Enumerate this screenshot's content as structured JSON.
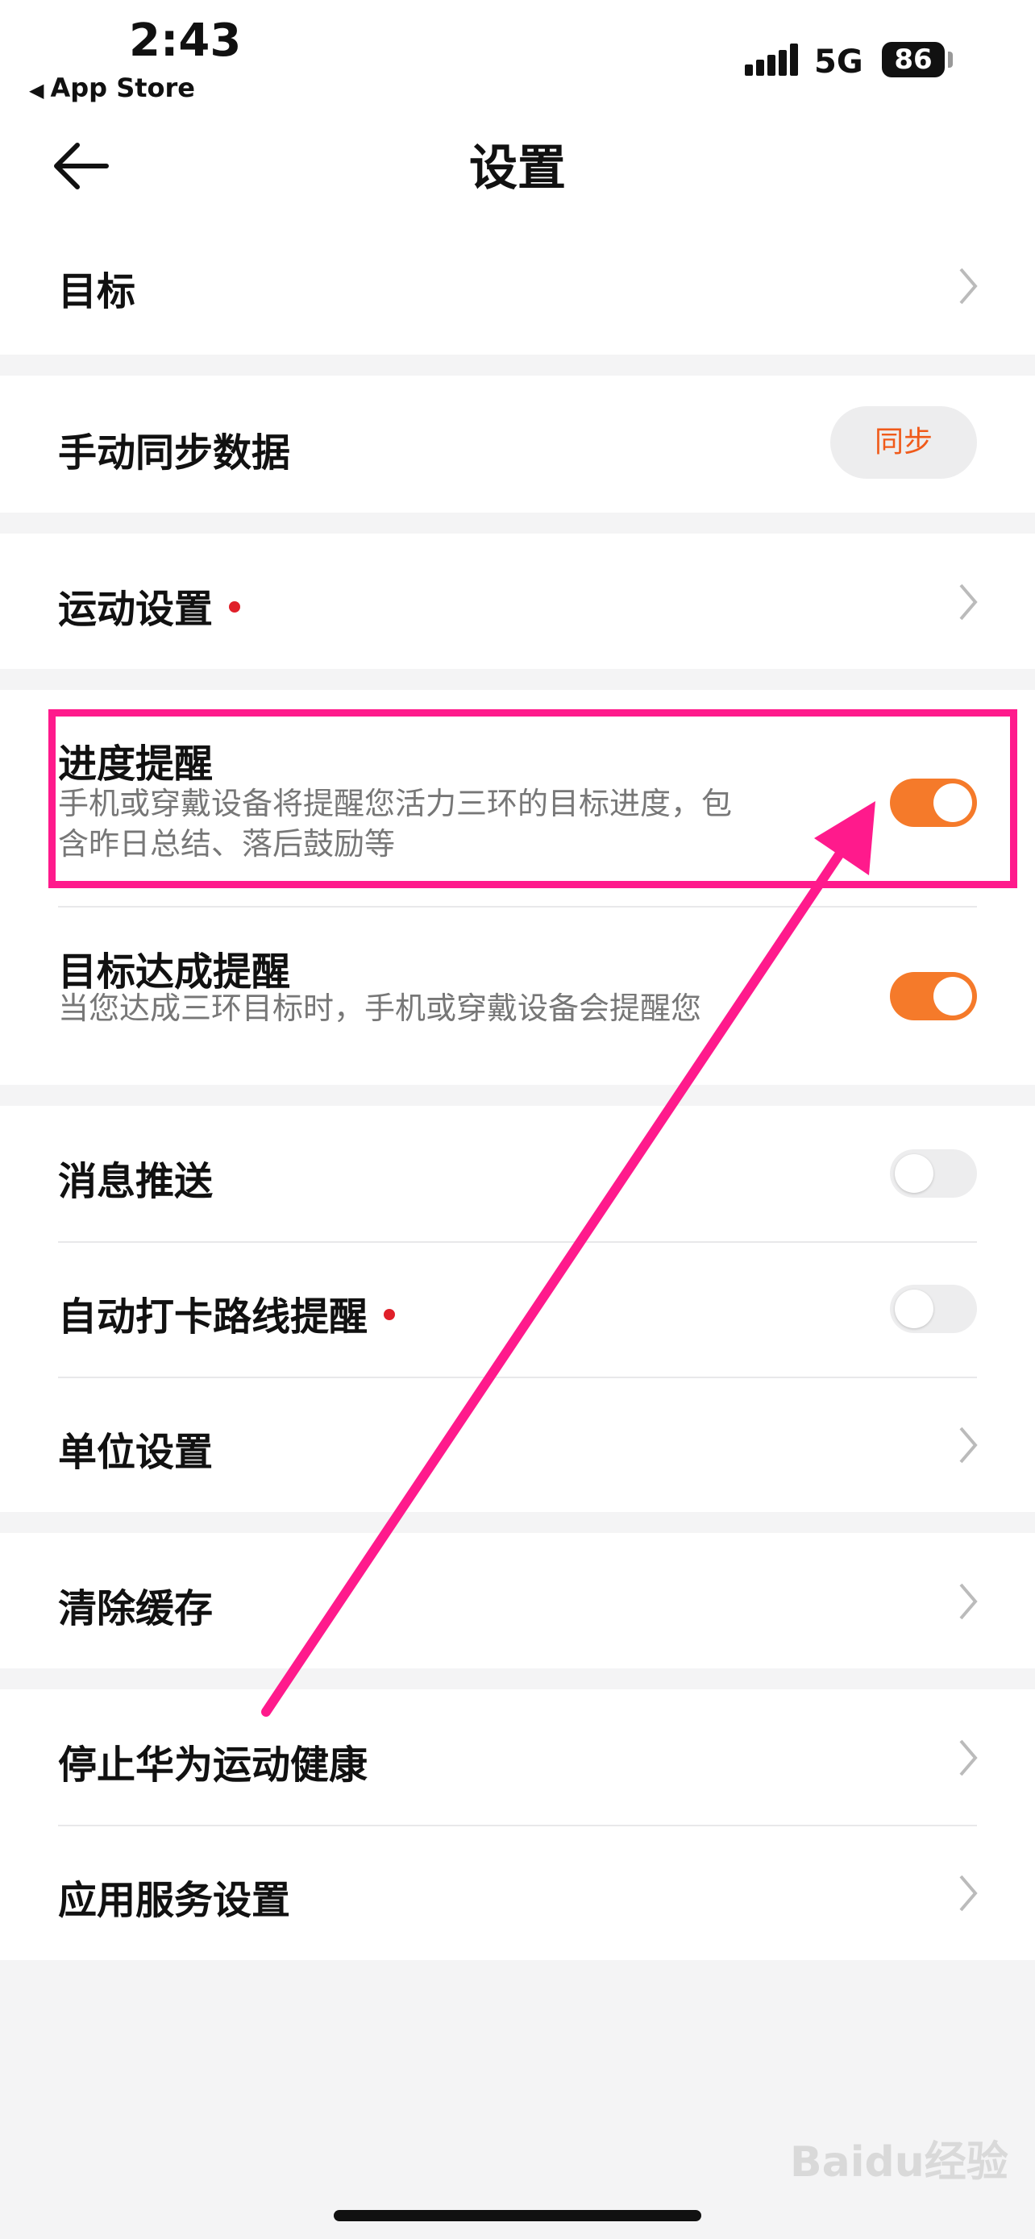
{
  "status_bar": {
    "time": "2:43",
    "back_app": "App Store",
    "network": "5G",
    "battery": "86"
  },
  "nav": {
    "title": "设置"
  },
  "sections": {
    "goal": {
      "label": "目标"
    },
    "manual_sync": {
      "label": "手动同步数据",
      "button": "同步"
    },
    "exercise": {
      "label": "运动设置"
    },
    "progress_reminder": {
      "label": "进度提醒",
      "desc_line1": "手机或穿戴设备将提醒您活力三环的目标进度，包",
      "desc_line2": "含昨日总结、落后鼓励等",
      "enabled": true
    },
    "goal_reminder": {
      "label": "目标达成提醒",
      "desc": "当您达成三环目标时，手机或穿戴设备会提醒您",
      "enabled": true
    },
    "push": {
      "label": "消息推送",
      "enabled": false
    },
    "auto_checkin": {
      "label": "自动打卡路线提醒",
      "enabled": false
    },
    "units": {
      "label": "单位设置"
    },
    "cache": {
      "label": "清除缓存"
    },
    "stop": {
      "label": "停止华为运动健康"
    },
    "app_service": {
      "label": "应用服务设置"
    }
  },
  "watermark": "Baidu经验",
  "colors": {
    "accent": "#f57a2a",
    "annotation": "#ff1a8c",
    "dot": "#e0202a"
  }
}
